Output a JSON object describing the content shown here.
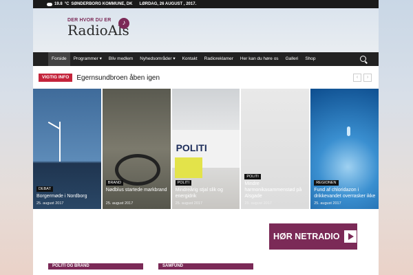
{
  "topbar": {
    "temperature": "19.8",
    "unit": "°C",
    "location": "SØNDERBORG KOMMUNE, DK",
    "date": "LØRDAG, 26 AUGUST , 2017."
  },
  "logo": {
    "tagline": "DER HVOR DU ER",
    "name": "RadioAls"
  },
  "nav": [
    "Forside",
    "Programmer ▾",
    "Bliv medlem",
    "Nyhedsområder ▾",
    "Kontakt",
    "Radioreklamer",
    "Her kan du høre os",
    "Galleri",
    "Shop"
  ],
  "ticker": {
    "badge": "VIGTIG INFO",
    "headline": "Egernsundbroen åben igen",
    "prev": "‹",
    "next": "›"
  },
  "tiles": [
    {
      "category": "DEBAT",
      "title": "Borgermøde i Nordborg",
      "date": "25. august 2017"
    },
    {
      "category": "BRAND",
      "title": "Nødblus startede markbrand",
      "date": "25. august 2017"
    },
    {
      "category": "POLITI",
      "title": "Mindreårig stjal slik og energidrik",
      "date": "25. august 2017",
      "image_text": "POLITI"
    },
    {
      "category": "POLITI",
      "title": "Mindre harmonikasammenstød på Alsgade",
      "date": "25. august 2017"
    },
    {
      "category": "REGIONEN",
      "title": "Fund af chloridazon i drikkevandet overrasker ikke",
      "date": "25. august 2017"
    }
  ],
  "radio_banner": "HØR NETRADIO",
  "sections": [
    "POLITI OG BRAND",
    "SAMFUND"
  ],
  "colors": {
    "accent": "#7b2a57",
    "badge": "#c4243b",
    "nav": "#222222"
  }
}
